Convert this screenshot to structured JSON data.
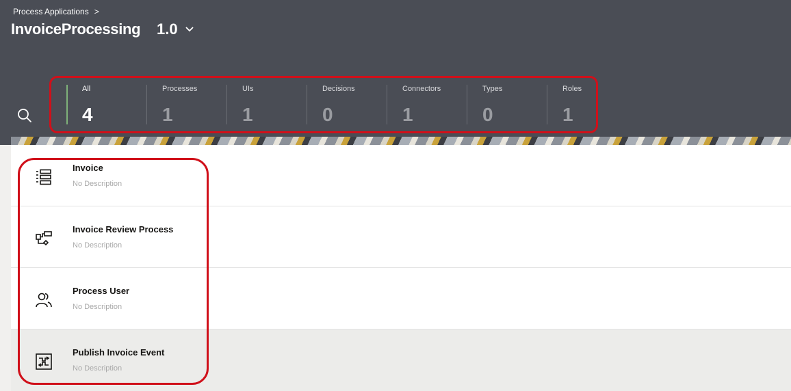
{
  "header": {
    "breadcrumb": "Process Applications",
    "breadcrumb_chevron": ">",
    "app_name": "InvoiceProcessing",
    "version": "1.0"
  },
  "icons": {
    "search": "search-icon",
    "version_dropdown": "chevron-down-icon"
  },
  "tabs": [
    {
      "label": "All",
      "count": "4"
    },
    {
      "label": "Processes",
      "count": "1"
    },
    {
      "label": "UIs",
      "count": "1"
    },
    {
      "label": "Decisions",
      "count": "0"
    },
    {
      "label": "Connectors",
      "count": "1"
    },
    {
      "label": "Types",
      "count": "0"
    },
    {
      "label": "Roles",
      "count": "1"
    }
  ],
  "items": [
    {
      "title": "Invoice",
      "description": "No Description",
      "icon": "form-list-icon"
    },
    {
      "title": "Invoice Review Process",
      "description": "No Description",
      "icon": "process-flow-icon"
    },
    {
      "title": "Process User",
      "description": "No Description",
      "icon": "users-icon"
    },
    {
      "title": "Publish Invoice Event",
      "description": "No Description",
      "icon": "integration-connector-icon"
    }
  ],
  "colors": {
    "header_bg": "#4a4d55",
    "highlight": "#d0101a",
    "active_tab_bar": "#7fb27a",
    "selected_row": "#ececea"
  }
}
